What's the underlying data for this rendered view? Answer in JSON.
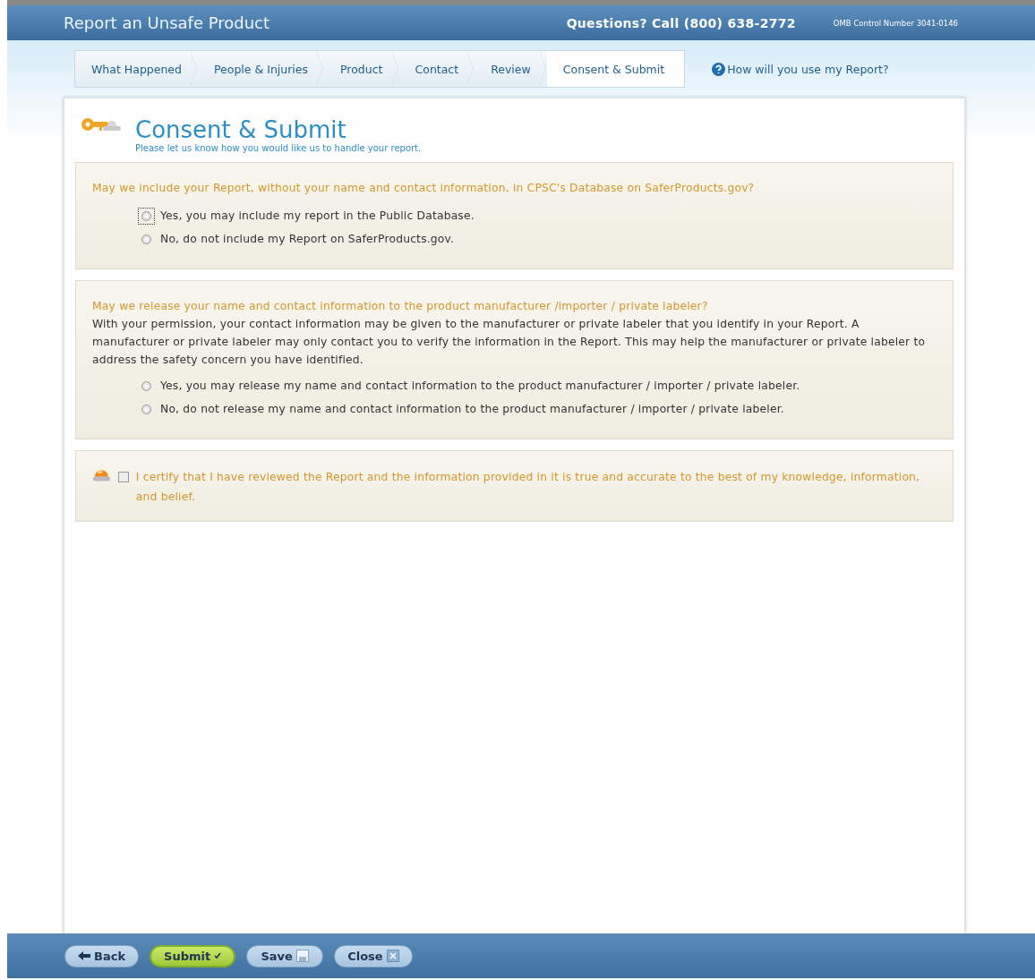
{
  "header": {
    "title": "Report an Unsafe Product",
    "phone": "Questions? Call (800) 638-2772",
    "omb": "OMB Control Number 3041-0146"
  },
  "steps": [
    {
      "label": "What Happened",
      "selected": false
    },
    {
      "label": "People & Injuries",
      "selected": false
    },
    {
      "label": "Product",
      "selected": false
    },
    {
      "label": "Contact",
      "selected": false
    },
    {
      "label": "Review",
      "selected": false
    },
    {
      "label": "Consent & Submit",
      "selected": true
    }
  ],
  "help_link": "How will you use my Report?",
  "page": {
    "title": "Consent & Submit",
    "subtitle": "Please let us know how you would like us to handle your report."
  },
  "sections": [
    {
      "kind": "radio",
      "question": "May we include your Report, without your name and contact information, in CPSC's Database on SaferProducts.gov?",
      "options": [
        {
          "label": "Yes, you may include my report in the Public Database.",
          "selected": false,
          "focused": true
        },
        {
          "label": "No, do not include my Report on SaferProducts.gov.",
          "selected": false,
          "focused": false
        }
      ]
    },
    {
      "kind": "radio",
      "question": "May we release your name and contact information to the product manufacturer /importer / private labeler?",
      "description": "With your permission, your contact information may be given to the manufacturer or private labeler that you identify in your Report. A manufacturer or private labeler may only contact you to verify the information in the Report. This may help the manufacturer or private labeler to address the safety concern you have identified.",
      "options": [
        {
          "label": "Yes, you may release my name and contact information to the product manufacturer / importer / private labeler.",
          "selected": false,
          "focused": false
        },
        {
          "label": "No, do not release my name and contact information to the product manufacturer / importer / private labeler.",
          "selected": false,
          "focused": false
        }
      ]
    },
    {
      "kind": "certify",
      "label": "I certify that I have reviewed the Report and the information provided in it is true and accurate to the best of my knowledge, information, and belief.",
      "checked": false
    }
  ],
  "footer_buttons": [
    {
      "kind": "back",
      "label": "Back"
    },
    {
      "kind": "submit",
      "label": "Submit"
    },
    {
      "kind": "save",
      "label": "Save"
    },
    {
      "kind": "close",
      "label": "Close"
    }
  ]
}
